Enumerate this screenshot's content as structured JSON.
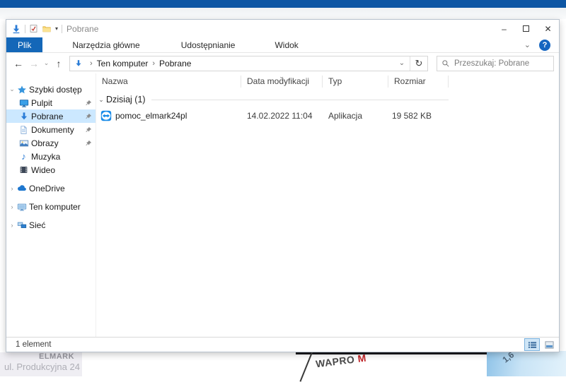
{
  "window": {
    "title": "Pobrane"
  },
  "glyphs": {
    "qat_dropdown": "▾",
    "minimize": "–",
    "close": "✕",
    "ribbon_collapse": "⌄",
    "help": "?",
    "back": "←",
    "forward": "→",
    "recent_locations": "⌄",
    "up": "↑",
    "crumb_separator": "›",
    "address_dropdown": "⌄",
    "refresh": "↻",
    "tree_expanded": "⌄",
    "tree_collapsed": "›",
    "sort_indicator": "⌄",
    "group_chevron": "⌄",
    "music_note": "♪"
  },
  "ribbon": {
    "tabs": [
      {
        "label": "Plik",
        "active": true
      },
      {
        "label": "Narzędzia główne",
        "active": false
      },
      {
        "label": "Udostępnianie",
        "active": false
      },
      {
        "label": "Widok",
        "active": false
      }
    ]
  },
  "navigation": {
    "breadcrumb": [
      "Ten komputer",
      "Pobrane"
    ],
    "search_placeholder": "Przeszukaj: Pobrane"
  },
  "sidebar": {
    "sections": [
      {
        "label": "Szybki dostęp",
        "icon": "quick-access-star-icon",
        "expanded": true,
        "items": [
          {
            "label": "Pulpit",
            "icon": "desktop-icon",
            "pinned": true,
            "selected": false
          },
          {
            "label": "Pobrane",
            "icon": "downloads-icon",
            "pinned": true,
            "selected": true
          },
          {
            "label": "Dokumenty",
            "icon": "documents-icon",
            "pinned": true,
            "selected": false
          },
          {
            "label": "Obrazy",
            "icon": "pictures-icon",
            "pinned": true,
            "selected": false
          },
          {
            "label": "Muzyka",
            "icon": "music-icon",
            "pinned": false,
            "selected": false
          },
          {
            "label": "Wideo",
            "icon": "video-icon",
            "pinned": false,
            "selected": false
          }
        ]
      },
      {
        "label": "OneDrive",
        "icon": "onedrive-cloud-icon",
        "expanded": false,
        "items": []
      },
      {
        "label": "Ten komputer",
        "icon": "this-pc-icon",
        "expanded": false,
        "items": []
      },
      {
        "label": "Sieć",
        "icon": "network-icon",
        "expanded": false,
        "items": []
      }
    ]
  },
  "file_list": {
    "columns": [
      "Nazwa",
      "Data modyfikacji",
      "Typ",
      "Rozmiar"
    ],
    "sorted_column": "Data modyfikacji",
    "group": {
      "label": "Dzisiaj",
      "count": "(1)"
    },
    "rows": [
      {
        "icon": "teamviewer-app-icon",
        "name": "pomoc_elmark24pl",
        "date_modified": "14.02.2022 11:04",
        "type": "Aplikacja",
        "size": "19 582 KB"
      }
    ]
  },
  "status_bar": {
    "items_count": "1 element",
    "views": [
      "details-view",
      "thumbnails-view"
    ],
    "active_view": "details-view"
  },
  "background": {
    "elmark_name": "ELMARK",
    "elmark_address": "ul. Produkcyjna 24",
    "wapro_brand": "WAPRO",
    "wapro_suffix": "M",
    "watermark_text": "1,6"
  },
  "colors": {
    "desktop_top_bar": "#0d56a4",
    "tab_active_bg": "#1467b8",
    "sidebar_selection": "#cce8ff",
    "icon_blue": "#2b7cd6",
    "help_circle_blue": "#1565c0",
    "teamviewer_blue": "#1a8ce8"
  }
}
